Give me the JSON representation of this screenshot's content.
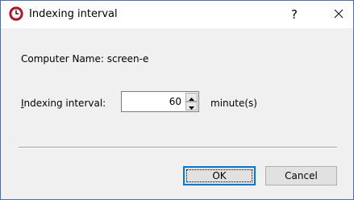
{
  "window": {
    "title": "Indexing interval",
    "help_label": "?",
    "app_icon": "clock-icon",
    "close_icon": "close-icon"
  },
  "content": {
    "computer_name_label": "Computer Name: screen-e",
    "interval_label_first": "I",
    "interval_label_rest": "ndexing interval:",
    "interval_value": "60",
    "units_label": "minute(s)"
  },
  "buttons": {
    "ok_label": "OK",
    "cancel_label": "Cancel"
  },
  "colors": {
    "accent": "#0078d7",
    "icon_red": "#c8102e"
  }
}
